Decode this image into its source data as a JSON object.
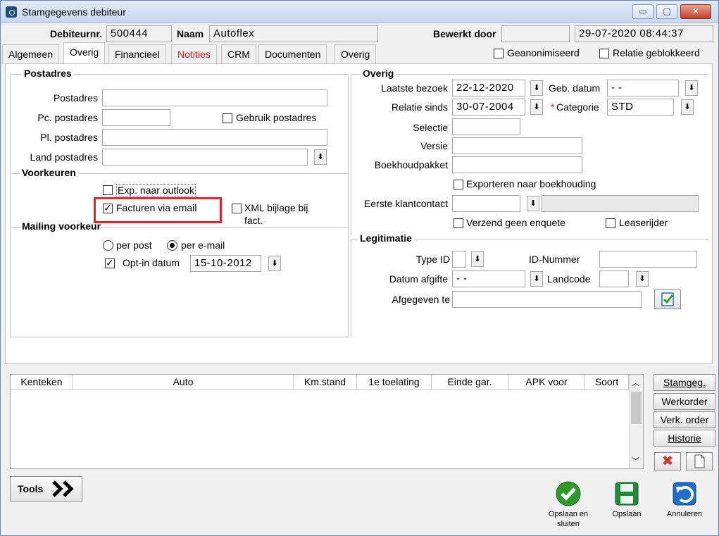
{
  "window": {
    "title": "Stamgegevens debiteur",
    "minimize": "▭",
    "maximize": "▢",
    "close": "✕"
  },
  "header": {
    "debiteurnr_label": "Debiteurnr.",
    "debiteurnr_value": "500444",
    "naam_label": "Naam",
    "naam_value": "Autoflex",
    "bewerkt_door_label": "Bewerkt door",
    "bewerkt_door_value": "",
    "datetime_value": "29-07-2020 08:44:37",
    "geanonimiseerd_label": "Geanonimiseerd",
    "relatie_geblokkeerd_label": "Relatie geblokkeerd"
  },
  "tabs": [
    "Algemeen",
    "Overig",
    "Financieel",
    "Notities",
    "CRM",
    "Documenten",
    "Overig"
  ],
  "postadres": {
    "title": "Postadres",
    "postadres_label": "Postadres",
    "pc_label": "Pc. postadres",
    "gebruik_label": "Gebruik postadres",
    "pl_label": "Pl. postadres",
    "land_label": "Land postadres"
  },
  "voorkeuren": {
    "title": "Voorkeuren",
    "outlook_label": "Exp. naar outlook",
    "facturen_label": "Facturen via email",
    "xml_label_1": "XML bijlage bij",
    "xml_label_2": "fact."
  },
  "mailing": {
    "title": "Mailing voorkeur",
    "per_post": "per post",
    "per_email": "per e-mail",
    "optin_label": "Opt-in datum",
    "optin_value": "15-10-2012"
  },
  "overig": {
    "title": "Overig",
    "laatste_bezoek_label": "Laatste bezoek",
    "laatste_bezoek_value": "22-12-2020",
    "geb_datum_label": "Geb. datum",
    "geb_datum_value": "-  -",
    "relatie_sinds_label": "Relatie sinds",
    "relatie_sinds_value": "30-07-2004",
    "categorie_star": "*",
    "categorie_label": "Categorie",
    "categorie_value": "STD",
    "selectie_label": "Selectie",
    "versie_label": "Versie",
    "boekhoud_label": "Boekhoudpakket",
    "exporteren_label": "Exporteren naar boekhouding",
    "eerste_label": "Eerste klantcontact",
    "verzend_label": "Verzend geen enquete",
    "lease_label": "Leaserijder"
  },
  "legitimatie": {
    "title": "Legitimatie",
    "type_id_label": "Type ID",
    "id_nummer_label": "ID-Nummer",
    "datum_afgifte_label": "Datum afgifte",
    "datum_afgifte_value": "-  -",
    "landcode_label": "Landcode",
    "afgegeven_label": "Afgegeven te"
  },
  "grid": {
    "columns": [
      "Kenteken",
      "Auto",
      "Km.stand",
      "1e toelating",
      "Einde gar.",
      "APK voor",
      "Soort"
    ]
  },
  "side_buttons": [
    "Stamgeg.",
    "Werkorder",
    "Verk. order",
    "Historie"
  ],
  "footer": {
    "tools": "Tools",
    "opslaan_en_sluiten_1": "Opslaan en",
    "opslaan_en_sluiten_2": "sluiten",
    "opslaan": "Opslaan",
    "annuleren": "Annuleren"
  },
  "colors": {
    "accent_red": "#e0201f",
    "highlight": "#e3202b",
    "ok_green": "#2e9a2e",
    "save_green": "#1e8a3a",
    "cancel_blue": "#1f6fc9"
  }
}
